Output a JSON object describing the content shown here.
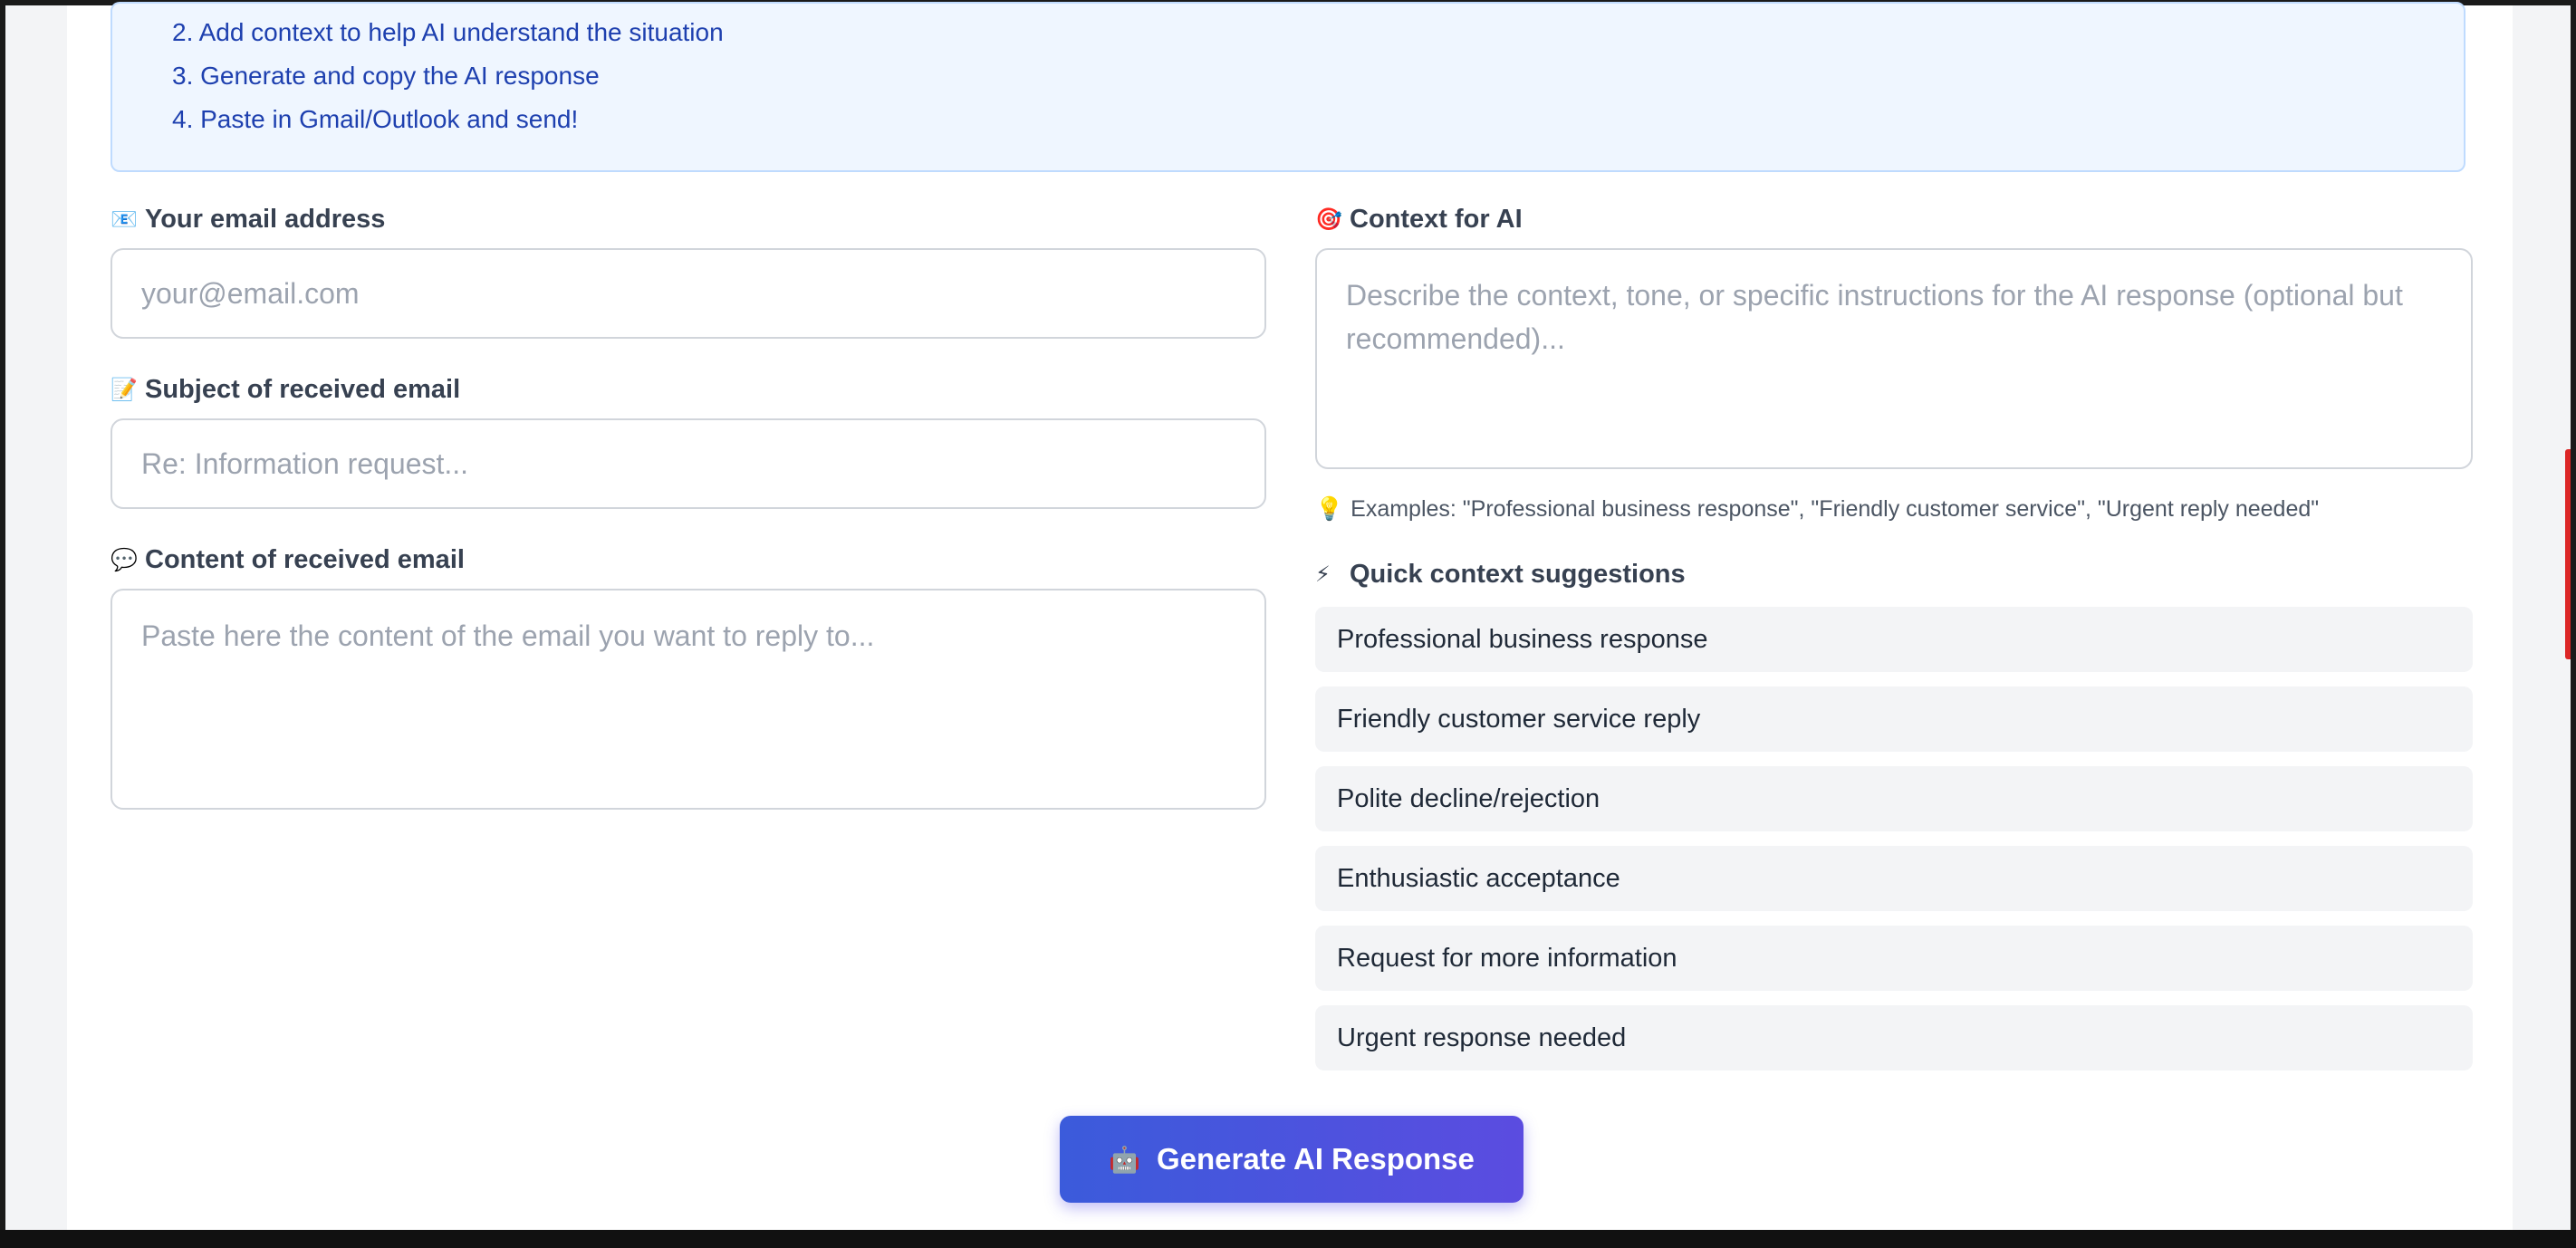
{
  "instructions": {
    "steps": [
      "2. Add context to help AI understand the situation",
      "3. Generate and copy the AI response",
      "4. Paste in Gmail/Outlook and send!"
    ]
  },
  "form": {
    "email": {
      "icon": "📧",
      "label": "Your email address",
      "placeholder": "your@email.com"
    },
    "subject": {
      "icon": "📝",
      "label": "Subject of received email",
      "placeholder": "Re: Information request..."
    },
    "content": {
      "icon": "💬",
      "label": "Content of received email",
      "placeholder": "Paste here the content of the email you want to reply to..."
    },
    "context": {
      "icon": "🎯",
      "label": "Context for AI",
      "placeholder": "Describe the context, tone, or specific instructions for the AI response (optional but recommended)...",
      "examples_icon": "💡",
      "examples": "Examples: \"Professional business response\", \"Friendly customer service\", \"Urgent reply needed\""
    }
  },
  "suggestions": {
    "icon": "⚡",
    "title": "Quick context suggestions",
    "items": [
      "Professional business response",
      "Friendly customer service reply",
      "Polite decline/rejection",
      "Enthusiastic acceptance",
      "Request for more information",
      "Urgent response needed"
    ]
  },
  "generate_button": {
    "icon": "🤖",
    "label": "Generate AI Response"
  },
  "colors": {
    "accent_start": "#3b5bdb",
    "accent_end": "#5b4ce0",
    "info_bg": "#eff6ff",
    "info_text": "#1e40af"
  }
}
